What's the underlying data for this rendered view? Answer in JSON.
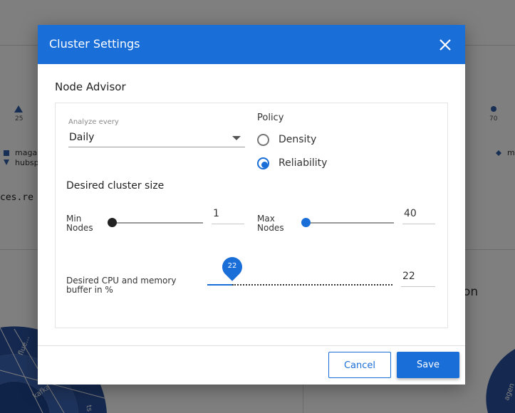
{
  "background": {
    "legend_items": [
      "magal",
      "hubsp",
      "m"
    ],
    "axis_ticks": [
      "25",
      "70"
    ],
    "code_fragment": "ces.re",
    "panel_fragment": "on",
    "donut_labels": [
      "flue...",
      "kafka",
      "ts",
      "agen"
    ]
  },
  "dialog": {
    "title": "Cluster Settings",
    "section_title": "Node Advisor",
    "analyze": {
      "label": "Analyze every",
      "value": "Daily"
    },
    "policy": {
      "label": "Policy",
      "options": [
        "Density",
        "Reliability"
      ],
      "selected": "Reliability"
    },
    "cluster_size": {
      "title": "Desired cluster size",
      "min_nodes": {
        "label_line1": "Min",
        "label_line2": "Nodes",
        "value": "1"
      },
      "max_nodes": {
        "label_line1": "Max",
        "label_line2": "Nodes",
        "value": "40"
      }
    },
    "buffer": {
      "label_line1": "Desired CPU and memory",
      "label_line2": "buffer in %",
      "value": "22",
      "pin_value": "22"
    },
    "buttons": {
      "cancel": "Cancel",
      "save": "Save"
    }
  },
  "colors": {
    "accent": "#1a6ed8",
    "header_bg": "#1a6ed8"
  }
}
